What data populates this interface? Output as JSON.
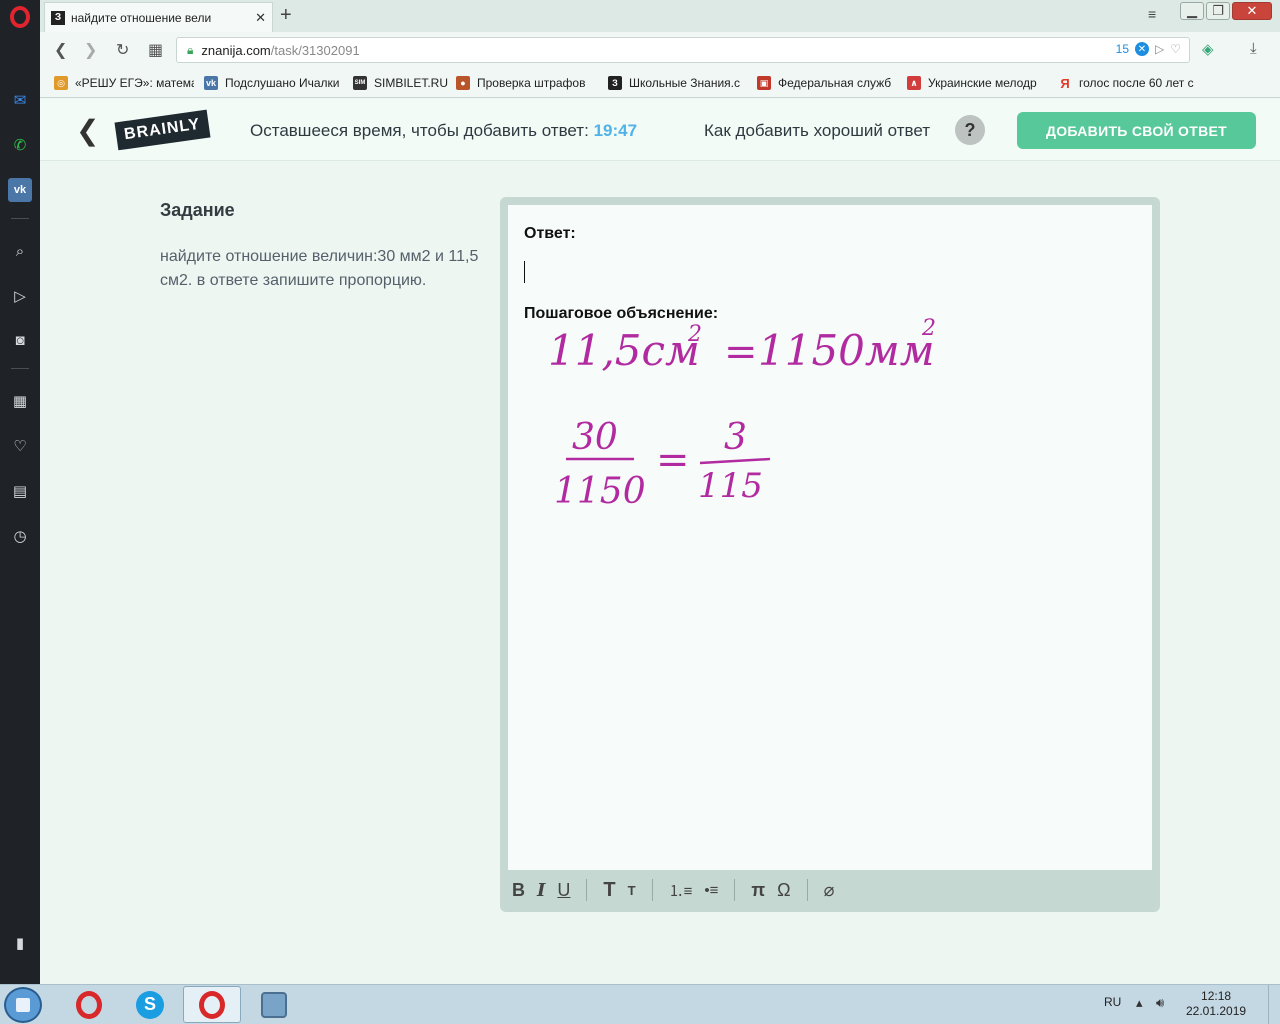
{
  "browser": {
    "tab_title": "найдите отношение вели",
    "tab_favicon": "З",
    "url_host": "znanija.com",
    "url_path": "/task/31302091",
    "badge_count": "15"
  },
  "bookmarks": [
    {
      "label": "«РЕШУ ЕГЭ»: матема",
      "color": "#e09a2a",
      "glyph": "◎"
    },
    {
      "label": "Подслушано Ичалки",
      "color": "#4a76a8",
      "glyph": "vk"
    },
    {
      "label": "SIMBILET.RU",
      "color": "#333333",
      "glyph": "SIM"
    },
    {
      "label": "Проверка штрафов",
      "color": "#b8552a",
      "glyph": "●"
    },
    {
      "label": "Школьные Знания.c",
      "color": "#222222",
      "glyph": "З"
    },
    {
      "label": "Федеральная служб",
      "color": "#c0392b",
      "glyph": "▣"
    },
    {
      "label": "Украинские мелодр",
      "color": "#d23c3c",
      "glyph": "∧"
    },
    {
      "label": "голос после 60 лет с",
      "color": "#e23b2a",
      "glyph": "Я"
    }
  ],
  "header": {
    "logo": "BRAINLY",
    "timer_label": "Оставшееся время, чтобы добавить ответ:",
    "timer_value": "19:47",
    "howto": "Как добавить хороший ответ",
    "help": "?",
    "add_button": "ДОБАВИТЬ СВОЙ ОТВЕТ"
  },
  "task": {
    "title": "Задание",
    "text": "найдите отношение величин:30 мм2 и 11,5 см2. в ответе запишите пропорцию."
  },
  "editor": {
    "answer_label": "Ответ:",
    "explanation_label": "Пошаговое объяснение:",
    "handwriting": {
      "line1_left": "11,5см",
      "line1_exp": "2",
      "equals": "=",
      "line1_right": "1150мм",
      "frac1_num": "30",
      "frac1_den": "1150",
      "frac2_num": "3",
      "frac2_den": "115"
    },
    "toolbar": {
      "bold": "B",
      "italic": "I",
      "underline": "U",
      "text_big": "T",
      "text_small": "T",
      "ordered_list": "⒈≡",
      "bullet_list": "•≡",
      "pi": "π",
      "omega": "Ω",
      "attach": "⌀"
    }
  },
  "taskbar": {
    "lang": "RU",
    "time": "12:18",
    "date": "22.01.2019"
  },
  "colors": {
    "accent_green": "#57c89a",
    "timer_blue": "#4fb3e8",
    "handwriting": "#b22aa0"
  }
}
